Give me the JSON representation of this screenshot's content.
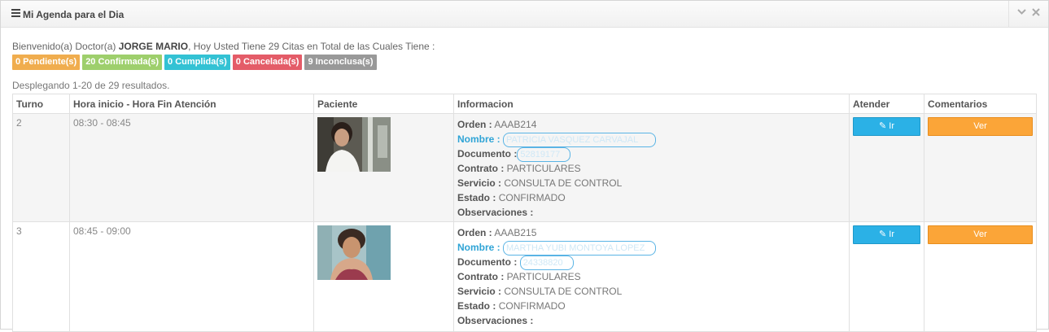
{
  "panel": {
    "title": "Mi Agenda para el Dia",
    "icon": "menu-icon",
    "controls": [
      "chevron-down-icon",
      "close-icon"
    ]
  },
  "welcome": {
    "prefix": "Bienvenido(a) Doctor(a) ",
    "doctor": "JORGE MARIO",
    "suffix": ", Hoy Usted Tiene 29 Citas en Total de las Cuales Tiene :"
  },
  "badges": [
    {
      "label": "0 Pendiente(s)",
      "color": "#f0ad4e"
    },
    {
      "label": "20 Confirmada(s)",
      "color": "#9ecf6c"
    },
    {
      "label": "0 Cumplida(s)",
      "color": "#33c2d4"
    },
    {
      "label": "0 Cancelada(s)",
      "color": "#e45c68"
    },
    {
      "label": "9 Inconclusa(s)",
      "color": "#999999"
    }
  ],
  "results_text": "Desplegando 1-20 de 29 resultados.",
  "table": {
    "headers": [
      "Turno",
      "Hora inicio - Hora Fin Atención",
      "Paciente",
      "Informacion",
      "Atender",
      "Comentarios"
    ],
    "labels": {
      "orden": "Orden :",
      "nombre": "Nombre :",
      "documento": "Documento :",
      "contrato": "Contrato :",
      "servicio": "Servicio :",
      "estado": "Estado :",
      "observaciones": "Observaciones :"
    },
    "rows": [
      {
        "turno": "2",
        "hora": "08:30 - 08:45",
        "orden": "AAAB214",
        "nombre": "PATRICIA VASQUEZ CARVAJAL",
        "documento": "52819177",
        "contrato": "PARTICULARES",
        "servicio": "CONSULTA DE CONTROL",
        "estado": "CONFIRMADO",
        "observaciones": "",
        "ir_label": "Ir",
        "ver_label": "Ver"
      },
      {
        "turno": "3",
        "hora": "08:45 - 09:00",
        "orden": "AAAB215",
        "nombre": "MARTHA YUBI MONTOYA LOPEZ",
        "documento": "24338820",
        "contrato": "PARTICULARES",
        "servicio": "CONSULTA DE CONTROL",
        "estado": "CONFIRMADO",
        "observaciones": "",
        "ir_label": "Ir",
        "ver_label": "Ver"
      }
    ]
  },
  "colors": {
    "ir_button": "#2bb1e6",
    "ver_button": "#fba538",
    "nombre_label": "#2fa4d6"
  }
}
